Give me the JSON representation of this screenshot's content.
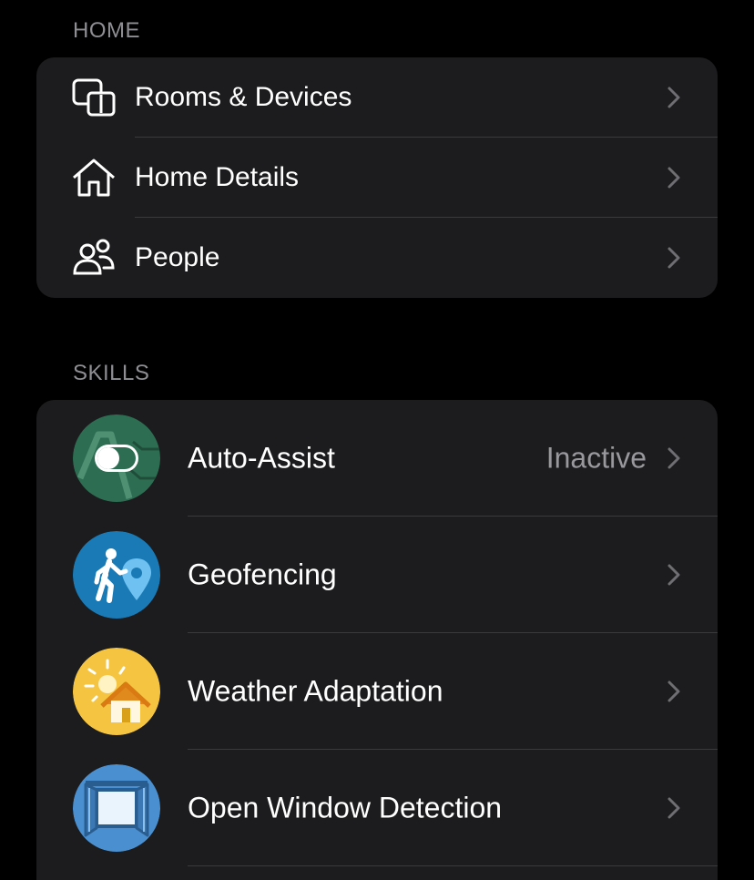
{
  "home": {
    "header": "HOME",
    "items": [
      {
        "label": "Rooms & Devices",
        "icon": "devices-icon"
      },
      {
        "label": "Home Details",
        "icon": "house-outline-icon"
      },
      {
        "label": "People",
        "icon": "people-icon"
      }
    ]
  },
  "skills": {
    "header": "SKILLS",
    "items": [
      {
        "label": "Auto-Assist",
        "status": "Inactive",
        "icon": "auto-assist-icon",
        "icon_color": "#2d6e53"
      },
      {
        "label": "Geofencing",
        "status": "",
        "icon": "geofencing-icon",
        "icon_color": "#1a7ab5"
      },
      {
        "label": "Weather Adaptation",
        "status": "",
        "icon": "weather-adaptation-icon",
        "icon_color": "#f5c542"
      },
      {
        "label": "Open Window Detection",
        "status": "",
        "icon": "open-window-icon",
        "icon_color": "#4a90d0"
      }
    ]
  },
  "colors": {
    "background": "#000000",
    "card": "#1c1c1e",
    "separator": "#3a3a3c",
    "secondary_text": "#8e8e93",
    "chevron": "#6e6e73"
  }
}
